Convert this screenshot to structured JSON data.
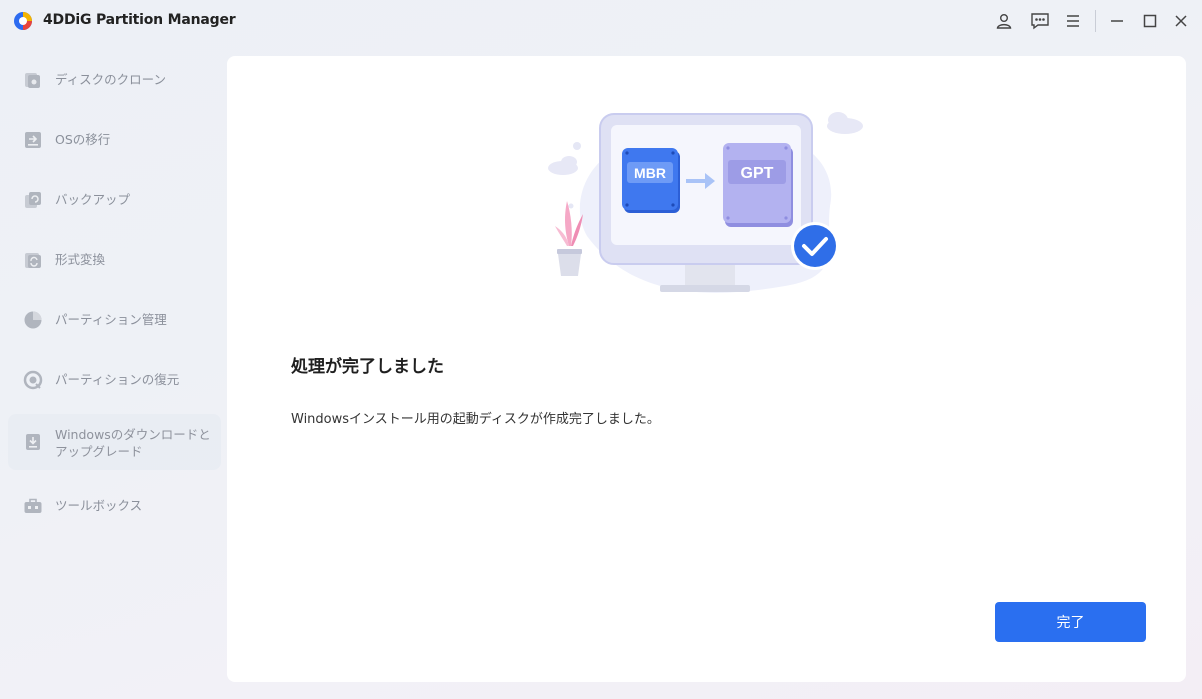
{
  "app": {
    "title": "4DDiG Partition Manager"
  },
  "titlebar_icons": [
    "account-icon",
    "feedback-icon",
    "menu-icon",
    "minimize-icon",
    "maximize-icon",
    "close-icon"
  ],
  "sidebar": {
    "items": [
      {
        "label": "ディスクのクローン",
        "icon": "disk-clone-icon"
      },
      {
        "label": "OSの移行",
        "icon": "os-migrate-icon"
      },
      {
        "label": "バックアップ",
        "icon": "backup-icon"
      },
      {
        "label": "形式変換",
        "icon": "format-convert-icon"
      },
      {
        "label": "パーティション管理",
        "icon": "partition-manage-icon"
      },
      {
        "label": "パーティションの復元",
        "icon": "partition-recovery-icon"
      },
      {
        "label": "Windowsのダウンロードと",
        "label2": "アップグレード",
        "icon": "windows-download-icon",
        "active": true
      },
      {
        "label": "ツールボックス",
        "icon": "toolbox-icon"
      }
    ]
  },
  "main": {
    "illustration": {
      "from_label": "MBR",
      "to_label": "GPT"
    },
    "heading": "処理が完了しました",
    "description": "Windowsインストール用の起動ディスクが作成完了しました。",
    "done_button": "完了"
  },
  "colors": {
    "accent": "#2a6ff0",
    "check_badge": "#2f6ee8",
    "mbr_block": "#3f78ef",
    "gpt_block": "#b3b2f0"
  }
}
